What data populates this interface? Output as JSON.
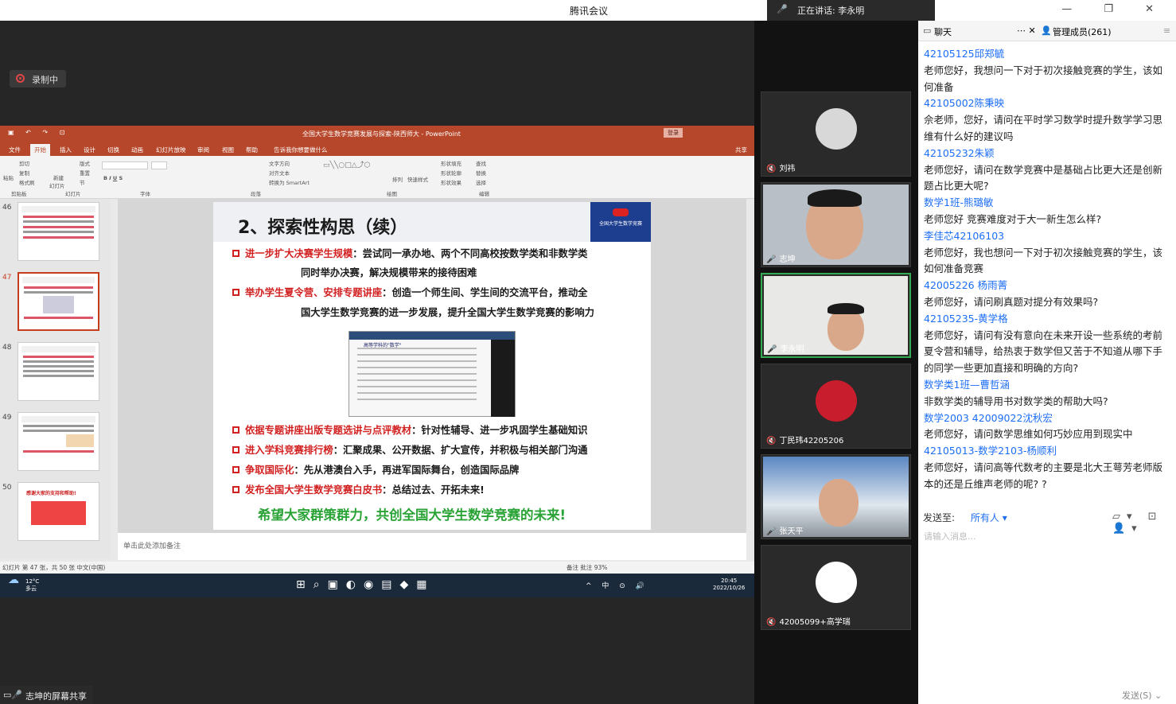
{
  "window": {
    "title": "腾讯会议",
    "controls": "— ❐ ✕"
  },
  "speaking": {
    "label": "正在讲话: 李永明"
  },
  "recording": {
    "label": "录制中"
  },
  "ppt": {
    "title": "全国大学生数学竞赛发展与探索-陕西师大  -  PowerPoint",
    "login": "登录",
    "tabs": [
      "文件",
      "开始",
      "插入",
      "设计",
      "切换",
      "动画",
      "幻灯片放映",
      "审阅",
      "视图",
      "帮助",
      "告诉我你想要做什么",
      "共享"
    ],
    "ribbon": {
      "clipboard": [
        "剪切",
        "复制",
        "格式刷",
        "粘贴",
        "剪贴板"
      ],
      "slides": [
        "新建",
        "幻灯片",
        "版式",
        "重置",
        "节",
        "幻灯片"
      ],
      "font": "字体",
      "paragraph": "段落",
      "drawing": "绘图",
      "editing": "编辑",
      "right": [
        "查找",
        "替换",
        "选择"
      ],
      "mid": [
        "文字方向",
        "对齐文本",
        "转换为 SmartArt",
        "排列",
        "快速样式",
        "形状填充",
        "形状轮廓",
        "形状效果"
      ]
    },
    "thumb_numbers": [
      "46",
      "47",
      "48",
      "49",
      "50"
    ],
    "thumb_labels": [
      "2、探索性构思",
      "2、探索性构思（续）",
      "3、赛后经验分享",
      "4、高校经验分享",
      "感谢大家的支持和帮助!"
    ],
    "slide": {
      "title": "2、探索性构思（续）",
      "logo": "全国大学生数学竞赛",
      "bullets": [
        {
          "head": "进一步扩大决赛学生规模",
          "body": "：尝试同一承办地、两个不同高校按数学类和非数学类",
          "cont": "同时举办决赛，解决规模带来的接待困难"
        },
        {
          "head": "举办学生夏令营、安排专题讲座",
          "body": "：创造一个师生间、学生间的交流平台，推动全",
          "cont": "国大学生数学竞赛的进一步发展，提升全国大学生数学竞赛的影响力"
        },
        {
          "head": "依据专题讲座出版专题选讲与点评教材",
          "body": "：针对性辅导、进一步巩固学生基础知识"
        },
        {
          "head": "进入学科竞赛排行榜",
          "body": "：汇聚成果、公开数据、扩大宣传，并积极与相关部门沟通"
        },
        {
          "head": "争取国际化",
          "body": "：先从港澳台入手，再进军国际舞台，创造国际品牌"
        },
        {
          "head": "发布全国大学生数学竞赛白皮书",
          "body": "：总结过去、开拓未来!"
        }
      ],
      "image_caption": "高等学科的\"数学\"",
      "footer": "希望大家群策群力，共创全国大学生数学竞赛的未来!"
    },
    "notes_placeholder": "单击此处添加备注",
    "status": "幻灯片 第 47 张，共 50 张    中文(中国)",
    "status_right": "备注   批注          93%"
  },
  "taskbar": {
    "temp": "12°C",
    "weather": "多云",
    "time": "20:45",
    "date": "2022/10/26",
    "tray": "^ 中 ⊙ 🔊"
  },
  "screen_share": {
    "label": "志坤的屏幕共享"
  },
  "participants": [
    {
      "name": "刘祎"
    },
    {
      "name": "志坤"
    },
    {
      "name": "李永明"
    },
    {
      "name": "丁民玮42205206"
    },
    {
      "name": "张天平"
    },
    {
      "name": "42005099+高学瑞"
    }
  ],
  "chat": {
    "tab_chat": "聊天",
    "tab_members": "管理成员(261)",
    "messages": [
      {
        "user": "42105125邱郑毓",
        "text": "老师您好，我想问一下对于初次接触竞赛的学生，该如何准备"
      },
      {
        "user": "42105002陈秉映",
        "text": "佘老师，您好，请问在平时学习数学时提升数学学习思维有什么好的建议吗"
      },
      {
        "user": "42105232朱颖",
        "text": "老师您好，请问在数学竞赛中是基础占比更大还是创新题占比更大呢?"
      },
      {
        "user": "数学1班-熊璐敏",
        "text": "老师您好 竞赛难度对于大一新生怎么样?"
      },
      {
        "user": "李佳芯42106103",
        "text": "老师您好，我也想问一下对于初次接触竞赛的学生，该如何准备竞赛"
      },
      {
        "user": "42005226 杨雨菁",
        "text": "老师您好，请问刷真题对提分有效果吗?"
      },
      {
        "user": "42105235-黄学格",
        "text": "老师您好，请问有没有意向在未来开设一些系统的考前夏令营和辅导，给热衷于数学但又苦于不知道从哪下手的同学一些更加直接和明确的方向?"
      },
      {
        "user": "数学类1班—曹哲涵",
        "text": "非数学类的辅导用书对数学类的帮助大吗?"
      },
      {
        "user": "数学2003  42009022沈秋宏",
        "text": "老师您好，请问数学思维如何巧妙应用到现实中"
      },
      {
        "user": "42105013-数学2103-杨顺利",
        "text": "老师您好，请问高等代数考的主要是北大王萼芳老师版本的还是丘维声老师的呢? ?"
      }
    ],
    "send_to_label": "发送至:",
    "send_to_value": "所有人 ▾",
    "input_placeholder": "请输入消息...",
    "send_button": "发送(S)"
  }
}
